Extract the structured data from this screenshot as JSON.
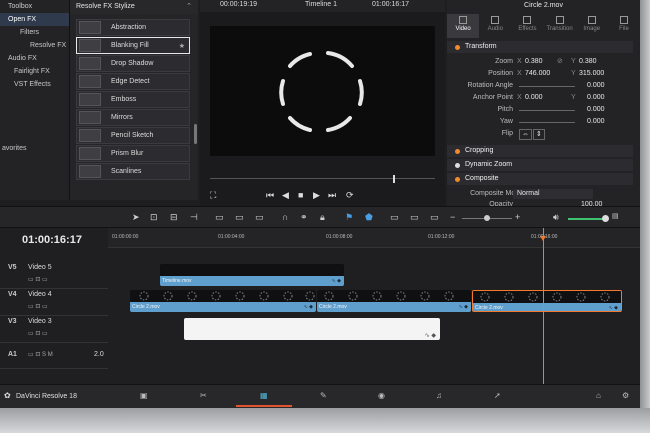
{
  "fx_tree": {
    "items": [
      {
        "label": "Toolbox",
        "level": 0,
        "selected": false
      },
      {
        "label": "Open FX",
        "level": 0,
        "selected": true
      },
      {
        "label": "Filters",
        "level": 1,
        "selected": false
      },
      {
        "label": "Resolve FX",
        "level": 1,
        "selected": false
      },
      {
        "label": "Audio FX",
        "level": 0,
        "selected": false
      },
      {
        "label": "Fairlight FX",
        "level": 1,
        "selected": false
      },
      {
        "label": "VST Effects",
        "level": 1,
        "selected": false
      }
    ],
    "favorites": "avorites"
  },
  "fx_grid": {
    "heading": "Resolve FX Stylize",
    "items": [
      "Abstraction",
      "Blanking Fill",
      "Drop Shadow",
      "Edge Detect",
      "Emboss",
      "Mirrors",
      "Pencil Sketch",
      "Prism Blur",
      "Scanlines"
    ],
    "selected_index": 1
  },
  "viewer": {
    "timecode_left": "00:00:19:19",
    "timeline_name": "Timeline 1",
    "timecode_right": "01:00:16:17"
  },
  "inspector": {
    "clip_title": "Circle 2.mov",
    "tabs": [
      "Video",
      "Audio",
      "Effects",
      "Transition",
      "Image",
      "File"
    ],
    "active_tab": "Video",
    "transform_label": "Transform",
    "zoom_label": "Zoom",
    "zoom_x": "0.380",
    "zoom_y": "0.380",
    "position_label": "Position",
    "position_x": "746.000",
    "position_y": "315.000",
    "rotation_label": "Rotation Angle",
    "rotation": "0.000",
    "anchor_label": "Anchor Point",
    "anchor_x": "0.000",
    "anchor_y": "0.000",
    "pitch_label": "Pitch",
    "pitch": "0.000",
    "yaw_label": "Yaw",
    "yaw": "0.000",
    "flip_label": "Flip",
    "cropping_label": "Cropping",
    "dynamic_zoom_label": "Dynamic Zoom",
    "composite_label": "Composite",
    "composite_mode_label": "Composite Mode",
    "composite_mode": "Normal",
    "opacity_label": "Opacity",
    "opacity": "100.00",
    "axis_x": "X",
    "axis_y": "Y"
  },
  "timeline": {
    "timecode": "01:00:16:17",
    "ruler": [
      "01:00:00:00",
      "01:00:04:00",
      "01:00:08:00",
      "01:00:12:00",
      "01:00:16:00"
    ],
    "tracks": [
      {
        "id": "V5",
        "name": "Video 5"
      },
      {
        "id": "V4",
        "name": "Video 4"
      },
      {
        "id": "V3",
        "name": "Video 3"
      },
      {
        "id": "A1",
        "name": "",
        "level": "2.0"
      }
    ],
    "clips": {
      "v5": "Timeline.mov",
      "v4a": "Circle 2.mov",
      "v4b": "Circle 2.mov",
      "v4c": "Circle 2.mov"
    }
  },
  "bottom_bar": {
    "app_name": "DaVinci Resolve 18",
    "active_page": "Edit"
  },
  "colors": {
    "accent": "#f27a2f",
    "clip": "#5f9fcd",
    "active_page": "#4fb8d8"
  }
}
